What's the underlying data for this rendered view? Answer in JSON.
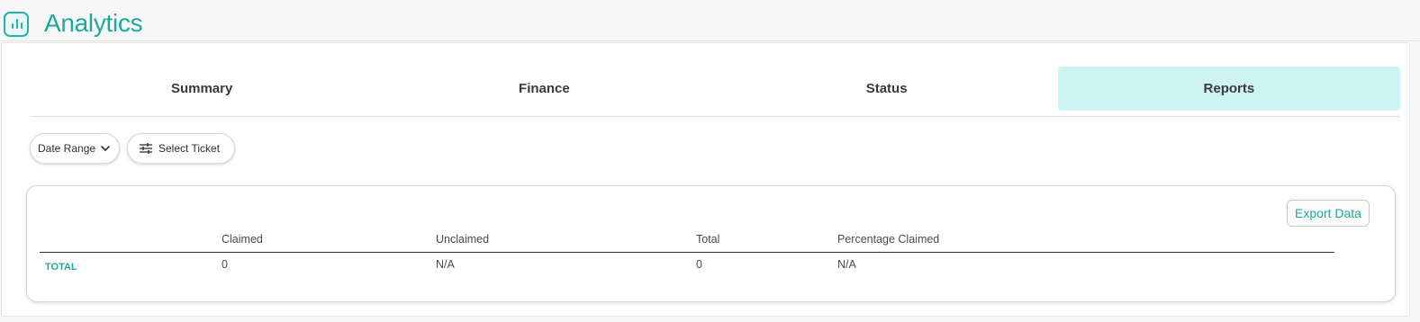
{
  "header": {
    "title": "Analytics",
    "icon": "bar-chart-icon"
  },
  "tabs": [
    {
      "label": "Summary",
      "active": false
    },
    {
      "label": "Finance",
      "active": false
    },
    {
      "label": "Status",
      "active": false
    },
    {
      "label": "Reports",
      "active": true
    }
  ],
  "filters": {
    "date_range_label": "Date Range",
    "select_ticket_label": "Select Ticket"
  },
  "report": {
    "export_label": "Export Data",
    "columns": [
      "Claimed",
      "Unclaimed",
      "Total",
      "Percentage Claimed"
    ],
    "rows": [
      {
        "label": "TOTAL",
        "values": [
          "0",
          "N/A",
          "0",
          "N/A"
        ]
      }
    ]
  },
  "colors": {
    "accent": "#1fa89e",
    "active_tab_bg": "#cdf3f3"
  }
}
